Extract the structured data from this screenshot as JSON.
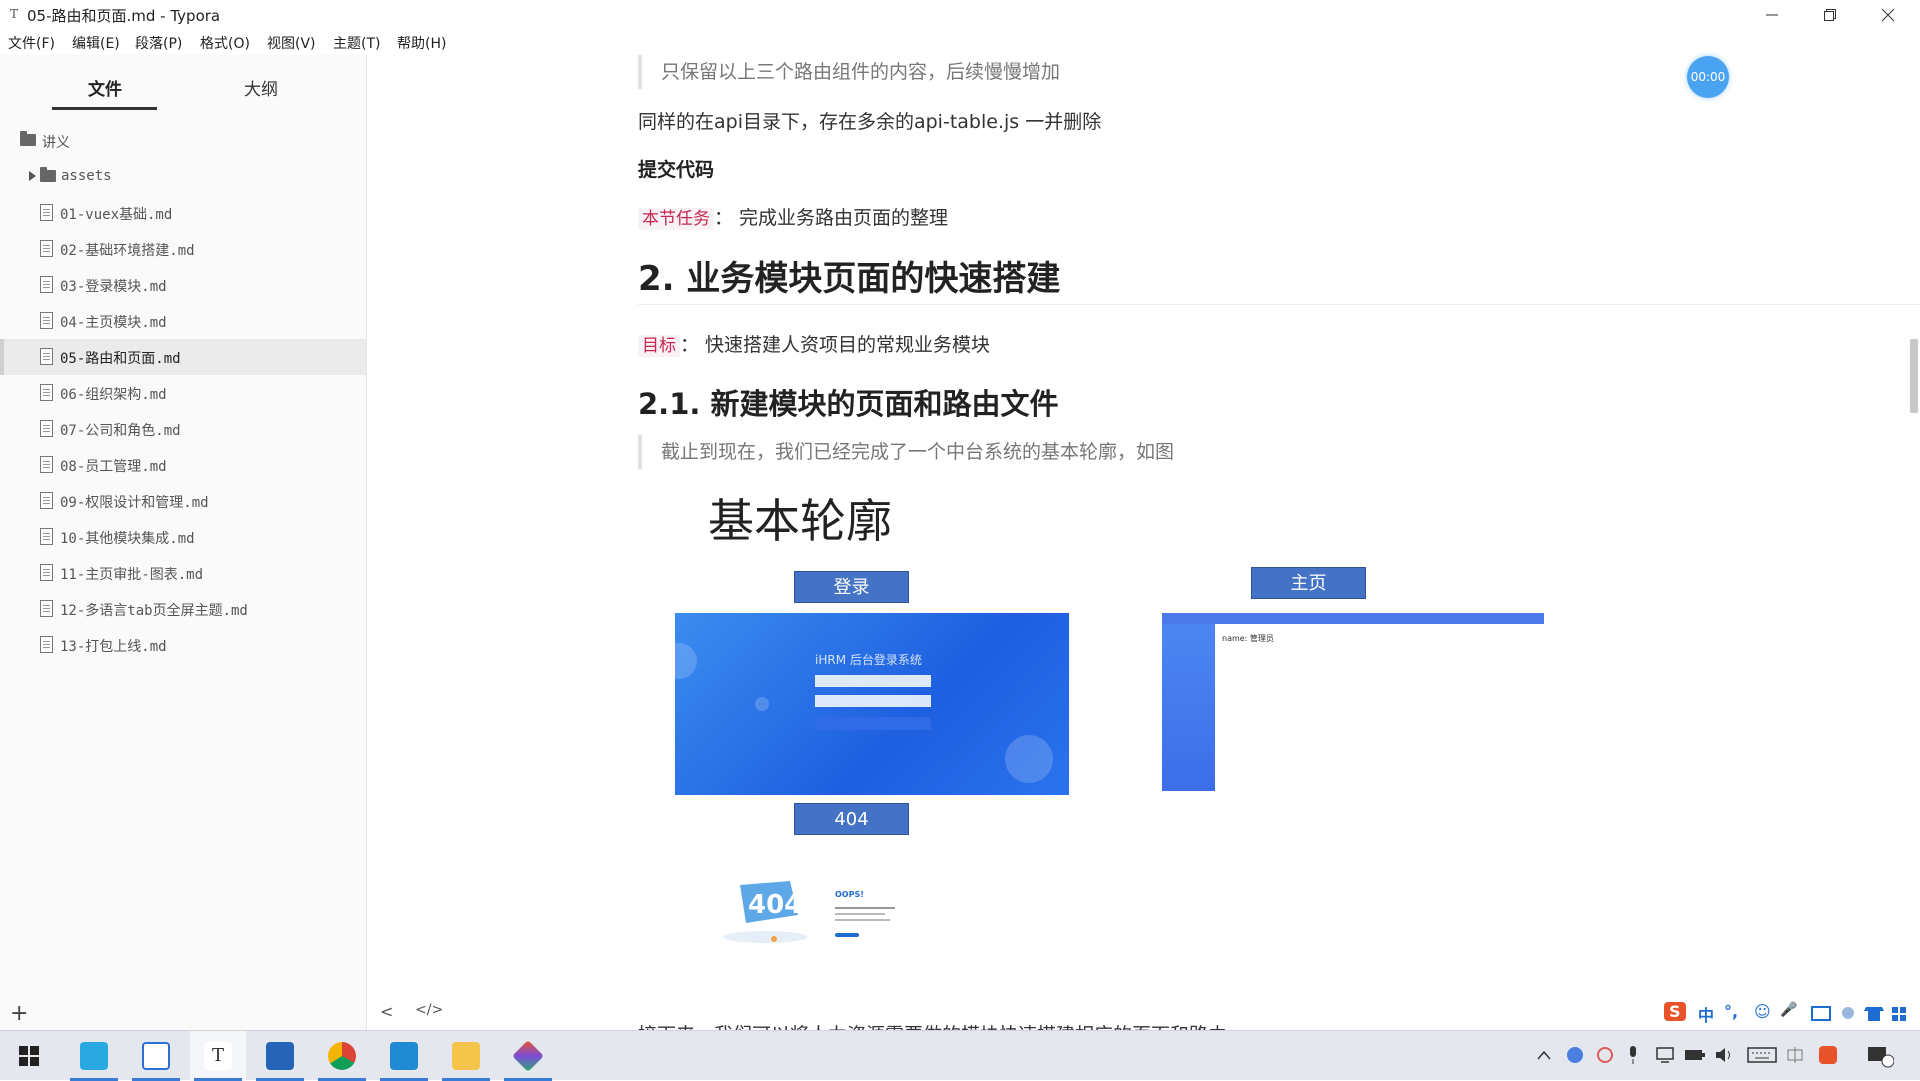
{
  "window": {
    "title": "05-路由和页面.md - Typora",
    "app_icon": "T"
  },
  "menu": [
    "文件(F)",
    "编辑(E)",
    "段落(P)",
    "格式(O)",
    "视图(V)",
    "主题(T)",
    "帮助(H)"
  ],
  "sidebar": {
    "tabs": [
      "文件",
      "大纲"
    ],
    "root": "讲义",
    "folder": "assets",
    "files": [
      "01-vuex基础.md",
      "02-基础环境搭建.md",
      "03-登录模块.md",
      "04-主页模块.md",
      "05-路由和页面.md",
      "06-组织架构.md",
      "07-公司和角色.md",
      "08-员工管理.md",
      "09-权限设计和管理.md",
      "10-其他模块集成.md",
      "11-主页审批-图表.md",
      "12-多语言tab页全屏主题.md",
      "13-打包上线.md"
    ],
    "active_index": 4,
    "add_label": "+"
  },
  "editor": {
    "quote1": "只保留以上三个路由组件的内容，后续慢慢增加",
    "para1": "同样的在api目录下，存在多余的api-table.js 一并删除",
    "bold1": "提交代码",
    "task_tag": "本节任务",
    "task_text": "： 完成业务路由页面的整理",
    "h2": "2. 业务模块页面的快速搭建",
    "goal_tag": "目标",
    "goal_text": "：  快速搭建人资项目的常规业务模块",
    "h3": "2.1. 新建模块的页面和路由文件",
    "quote2": "截止到现在，我们已经完成了一个中台系统的基本轮廓，如图",
    "cutoff": "接下来，我们可以将人力资源需要做的模块快速搭建相应的页面和路由"
  },
  "diagram": {
    "title": "基本轮廓",
    "login_label": "登录",
    "home_label": "主页",
    "notfound_label": "404",
    "login_screen_title": "iHRM 后台登录系统",
    "home_screen_text": "name: 管理员",
    "notfound_big": "404",
    "notfound_oops": "OOPS!"
  },
  "timer": "00:00",
  "footer": {
    "back": "<",
    "source": "</>"
  },
  "ime": [
    "S",
    "中",
    "°,",
    "☺",
    "🎤"
  ],
  "colors": {
    "accent": "#4472c4",
    "tag_red": "#c7254e",
    "timer": "#4aa3f0"
  }
}
